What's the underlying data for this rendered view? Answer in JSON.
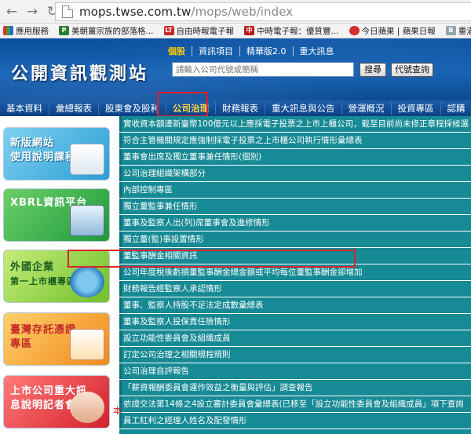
{
  "browser": {
    "url_host": "mops.twse.com.tw",
    "url_path": "/mops/web/index",
    "bookmarks": [
      "應用服務",
      "美朝薑宗族的部落格...",
      "自由時報電子報",
      "中時電子報：優質豐...",
      "今日蘋果 | 蘋果日報",
      "重灌狂人 | 地"
    ]
  },
  "header": {
    "site_title": "公開資訊觀測站",
    "top_links": [
      "個股",
      "資訊項目",
      "精華版2.0",
      "重大訊息"
    ],
    "search_placeholder": "請輸入公司代號或簡稱",
    "search_button": "搜尋",
    "code_button": "代號查詢"
  },
  "menu": {
    "items": [
      "基本資料",
      "彙總報表",
      "股東會及股利",
      "公司治理",
      "財務報表",
      "重大訊息與公告",
      "營運概況",
      "投資專區",
      "認購（售）權"
    ],
    "highlighted": "公司治理"
  },
  "sidebar": {
    "cards": [
      {
        "line1": "新版網站",
        "line2": "使用說明課程"
      },
      {
        "line1": "XBRL資訊平台",
        "line2": ""
      },
      {
        "line1": "外國企業",
        "line2": "第一上市櫃專區"
      },
      {
        "line1": "臺灣存託憑證",
        "line2": "專區"
      },
      {
        "line1": "上市公司重大訊",
        "line2": "息說明記者會"
      }
    ]
  },
  "content": {
    "rows": [
      "實收資本額達新臺幣100億元以上應採電子投票之上市上櫃公司，截至目前尚未修正章程採候選",
      "符合主管機關規定應強制採電子投票之上市櫃公司執行情形彙總表",
      "董事會出席及獨立董事兼任情形(個別)",
      "公司治理組織架構部分",
      "內部控制專區",
      "獨立董監事兼任情形",
      "董事及監察人出(列)席董事會及進修情形",
      "獨立董(監)事設置情形",
      "董監事酬金相關資訊",
      "公司年度稅後虧損董監事酬金總金額或平均每位董監事酬金卻增加",
      "財務報告經監察人承認情形",
      "董事、監察人持股不足法定成數彙總表",
      "董事及監察人投保責任險情形",
      "設立功能性委員會及組織成員",
      "訂定公司治理之相關規程規則",
      "公司治理自評報告",
      "「薪資報酬委員會運作效益之衡量與評估」調查報告",
      "依證交法第14條之4設立審計委員會彙總表(已移至「設立功能性委員會及組織成員」項下查詢",
      "員工紅利之經理人姓名及配發情形"
    ],
    "highlighted_row": "董監事酬金相關資訊",
    "stray_text": "本"
  }
}
